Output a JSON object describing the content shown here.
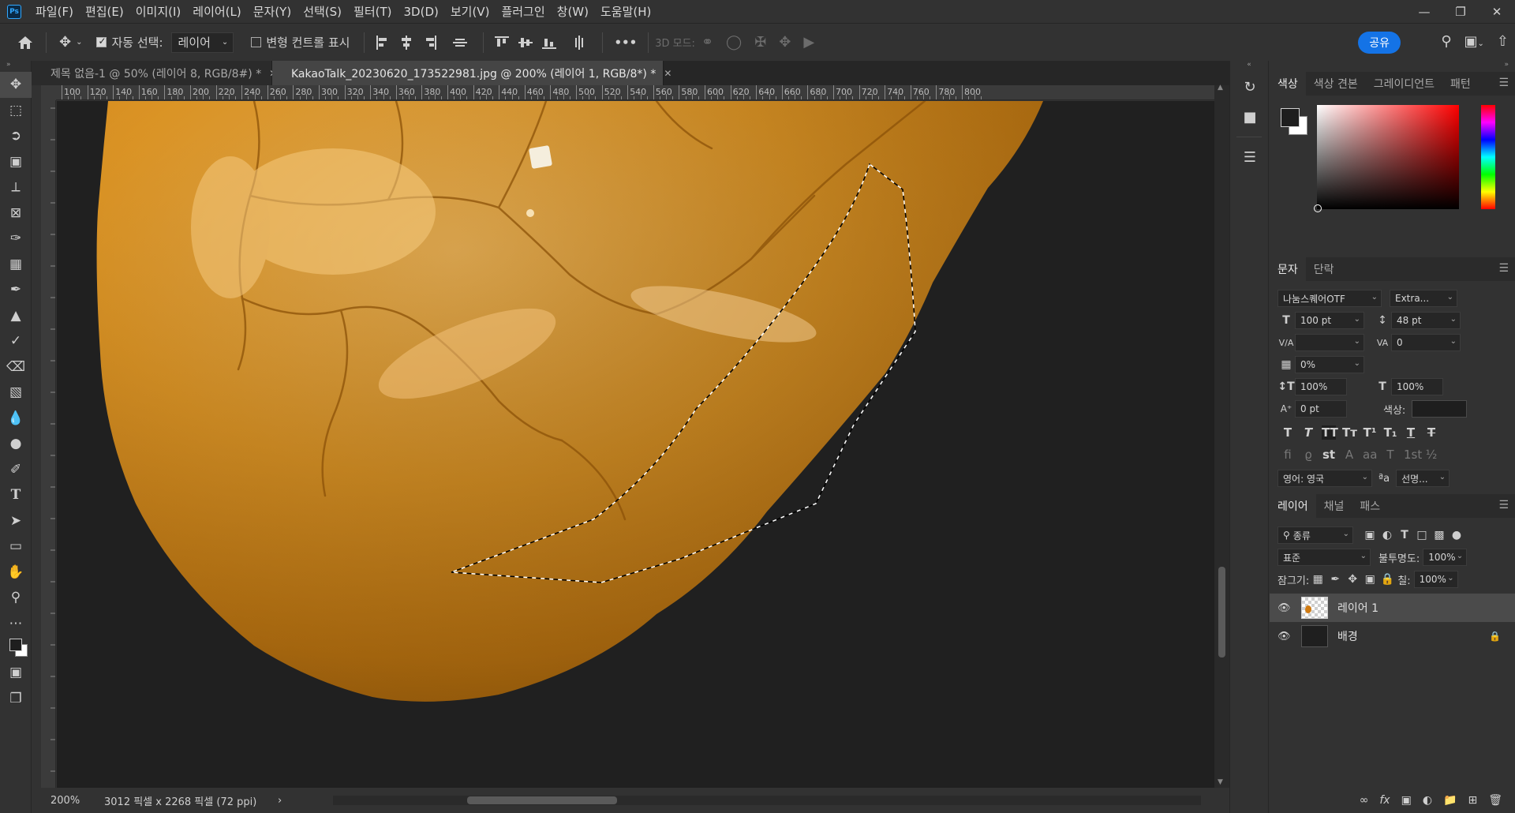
{
  "menubar": {
    "logo": "Ps",
    "items": [
      "파일(F)",
      "편집(E)",
      "이미지(I)",
      "레이어(L)",
      "문자(Y)",
      "선택(S)",
      "필터(T)",
      "3D(D)",
      "보기(V)",
      "플러그인",
      "창(W)",
      "도움말(H)"
    ]
  },
  "options": {
    "auto_select_label": "자동 선택:",
    "auto_select_value": "레이어",
    "transform_controls_label": "변형 컨트롤 표시",
    "three_d_mode_label": "3D 모드:",
    "more": "•••",
    "share_label": "공유"
  },
  "tabs": [
    {
      "title": "제목 없음-1 @ 50% (레이어 8, RGB/8#) *",
      "active": false
    },
    {
      "title": "KakaoTalk_20230620_173522981.jpg @ 200% (레이어 1, RGB/8*) *",
      "active": true
    }
  ],
  "ruler": {
    "labels": [
      "100",
      "120",
      "140",
      "160",
      "180",
      "200",
      "220",
      "240",
      "260",
      "280",
      "300",
      "320",
      "340",
      "360",
      "380",
      "400",
      "420",
      "440",
      "460",
      "480",
      "500",
      "520",
      "540",
      "560",
      "580",
      "600",
      "620",
      "640",
      "660",
      "680",
      "700",
      "720",
      "740",
      "760",
      "780",
      "800"
    ]
  },
  "status": {
    "zoom": "200%",
    "info": "3012 픽셀 x 2268 픽셀 (72 ppi)",
    "arrow": "›"
  },
  "color_panel": {
    "tabs": [
      "색상",
      "색상 견본",
      "그레이디언트",
      "패턴"
    ],
    "foreground": "#1e1e1e",
    "background": "#ffffff",
    "hue": "#ff0000"
  },
  "character_panel": {
    "tabs": [
      "문자",
      "단락"
    ],
    "font_family": "나눔스퀘어OTF",
    "font_style": "Extra...",
    "font_size": "100 pt",
    "leading": "48 pt",
    "kerning": "",
    "tracking": "0",
    "tsume": "0%",
    "vertical_scale": "100%",
    "horizontal_scale": "100%",
    "baseline_shift": "0 pt",
    "color_label": "색상:",
    "language": "영어: 영국",
    "aa_label": "ªa",
    "antialias": "선명..."
  },
  "layers_panel": {
    "tabs": [
      "레이어",
      "채널",
      "패스"
    ],
    "filter_label": "종류",
    "blend_mode": "표준",
    "opacity_label": "불투명도:",
    "opacity": "100%",
    "lock_label": "잠그기:",
    "fill_label": "칠:",
    "fill": "100%",
    "layers": [
      {
        "name": "레이어 1",
        "selected": true,
        "locked": false
      },
      {
        "name": "배경",
        "selected": false,
        "locked": true
      }
    ]
  },
  "colors": {
    "bread_light": "#e8a032",
    "bread_dark": "#b8700c",
    "canvas_bg": "#202020",
    "accent": "#1473e6"
  }
}
